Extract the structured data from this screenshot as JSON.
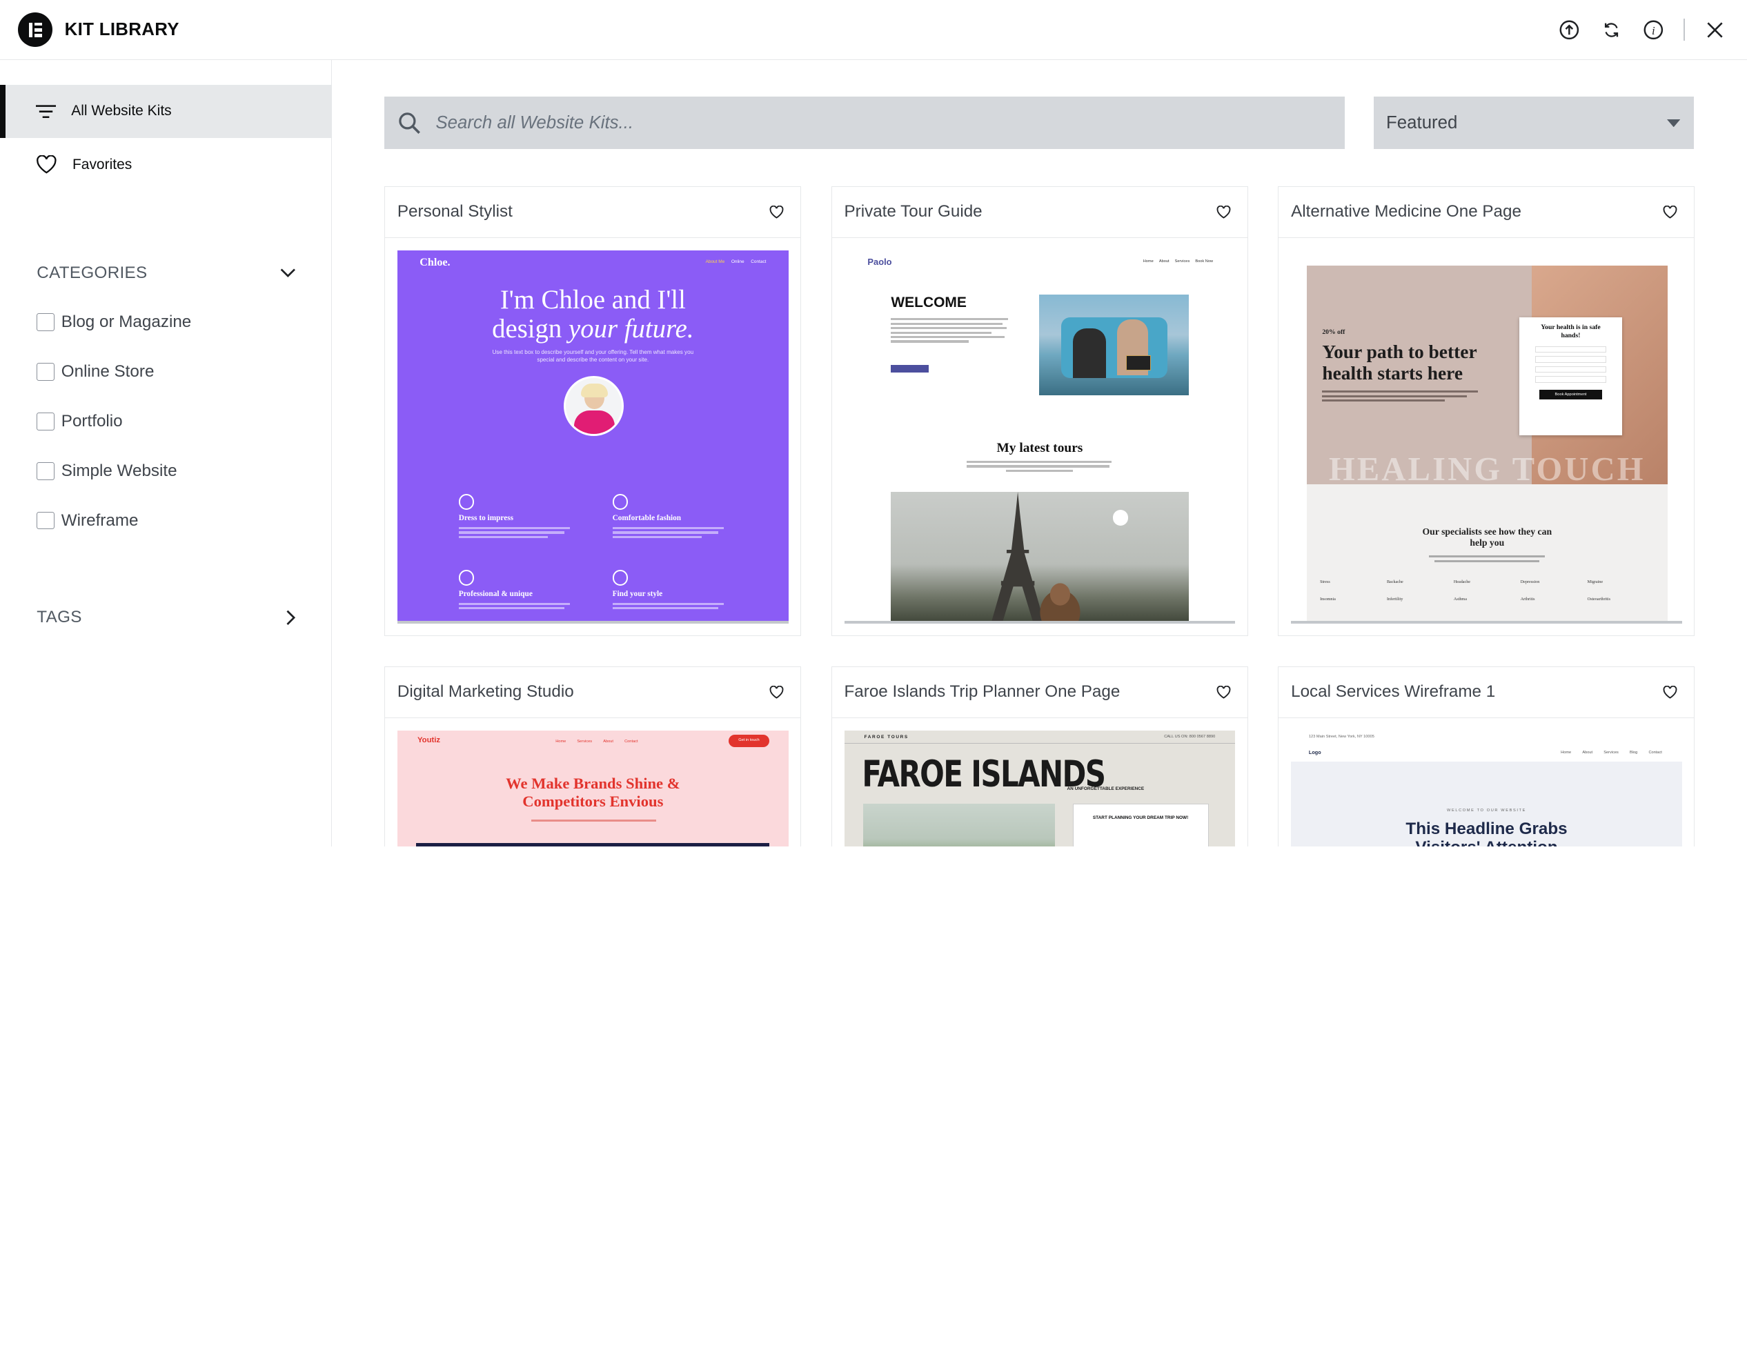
{
  "header": {
    "title": "KIT LIBRARY"
  },
  "sidebar": {
    "nav": [
      {
        "label": "All Website Kits"
      },
      {
        "label": "Favorites"
      }
    ],
    "categories_title": "CATEGORIES",
    "categories": [
      "Blog or Magazine",
      "Online Store",
      "Portfolio",
      "Simple Website",
      "Wireframe"
    ],
    "tags_title": "TAGS"
  },
  "search": {
    "placeholder": "Search all Website Kits..."
  },
  "sort": {
    "selected": "Featured"
  },
  "kits": [
    {
      "title": "Personal Stylist",
      "preview": {
        "logo": "Chloe.",
        "menu": [
          "About Me",
          "Online",
          "Contact"
        ],
        "headline1": "I'm Chloe and I'll",
        "headline2a": "design ",
        "headline2b": "your future.",
        "sub": "Use this text box to describe yourself and your offering. Tell them what makes you special and describe the content on your site.",
        "f1": "Dress to impress",
        "f2": "Comfortable fashion",
        "f3": "Professional & unique",
        "f4": "Find your style"
      }
    },
    {
      "title": "Private Tour Guide",
      "preview": {
        "logo": "Paolo",
        "menu": [
          "Home",
          "About",
          "Services",
          "Book Now"
        ],
        "welcome": "WELCOME",
        "tours": "My latest tours"
      }
    },
    {
      "title": "Alternative Medicine One Page",
      "preview": {
        "small": "20% off",
        "headline": "Your path to better health starts here",
        "formtitle": "Your health is in safe hands!",
        "formbtn": "Book Appointment",
        "watermark": "HEALING TOUCH",
        "specialists": "Our specialists see how they can help you",
        "conditions": [
          "Stress",
          "Backache",
          "Headache",
          "Depression",
          "Migraine",
          "Insomnia",
          "Infertility",
          "Asthma",
          "Arthritis",
          "Osteoarthritis"
        ]
      }
    },
    {
      "title": "Digital Marketing Studio",
      "preview": {
        "logo": "Youtiz",
        "menu": [
          "Home",
          "Services",
          "About",
          "Contact"
        ],
        "cta": "Get in touch",
        "headline": "We Make Brands Shine & Competitors Envious"
      }
    },
    {
      "title": "Faroe Islands Trip Planner One Page",
      "preview": {
        "brand": "FAROE TOURS",
        "phone": "CALL US ON: 800 0567 8890",
        "headline": "FAROE ISLANDS",
        "tag": "AN UNFORGETTABLE EXPERIENCE",
        "box": "START PLANNING YOUR DREAM TRIP NOW!"
      }
    },
    {
      "title": "Local Services Wireframe 1",
      "preview": {
        "address": "123 Main Street, New York, NY 10005",
        "logo": "Logo",
        "menu": [
          "Home",
          "About",
          "Services",
          "Blog",
          "Contact"
        ],
        "welcome": "WELCOME TO OUR WEBSITE",
        "headline": "This Headline Grabs Visitors' Attention"
      }
    }
  ],
  "colors": {
    "stylist_bg": "#8b5cf6",
    "marketing_bg": "#fbd9dc",
    "marketing_red": "#e2342d",
    "faroe_bg": "#e4e2dc"
  }
}
